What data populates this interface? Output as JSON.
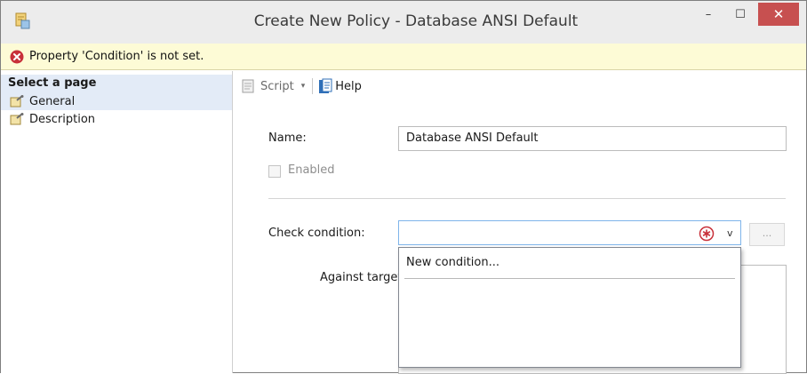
{
  "window": {
    "title": "Create New Policy - Database ANSI Default",
    "icons": {
      "app": "policy-app-icon",
      "minimize": "minimize-icon",
      "maximize": "maximize-icon",
      "close": "close-icon"
    },
    "minimize_glyph": "–",
    "maximize_glyph": "☐",
    "close_glyph": "✕"
  },
  "error_bar": {
    "icon": "error-circle-icon",
    "message": "Property 'Condition' is not set."
  },
  "page_selector": {
    "header": "Select a page",
    "items": [
      {
        "label": "General",
        "icon": "page-wrench-icon",
        "selected": true
      },
      {
        "label": "Description",
        "icon": "page-wrench-icon",
        "selected": false
      }
    ]
  },
  "toolbar": {
    "script_label": "Script",
    "script_caret": "▾",
    "help_label": "Help"
  },
  "form": {
    "name_label": "Name:",
    "name_value": "Database ANSI Default",
    "enabled_label": "Enabled",
    "enabled_checked": false,
    "check_condition_label": "Check condition:",
    "check_condition_value": "",
    "combo_caret": "v",
    "ellipsis_label": "...",
    "against_targets_label": "Against targets",
    "dropdown_options": [
      "New condition..."
    ]
  },
  "colors": {
    "titlebar": "#ececec",
    "close_button": "#c75050",
    "error_bar": "#fdfbd6",
    "selected_item": "#e3ebf7",
    "focus_border": "#7eb4ea",
    "error_red": "#c8313a"
  }
}
